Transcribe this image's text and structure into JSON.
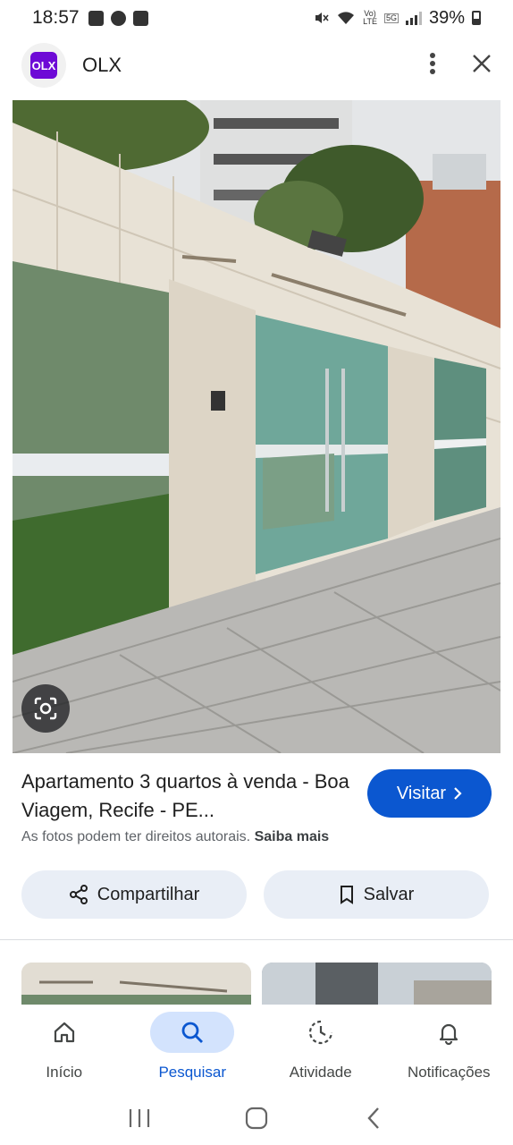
{
  "status_bar": {
    "time": "18:57",
    "battery": "39%",
    "network_labels": [
      "Vo)",
      "LTE",
      "5G"
    ],
    "icons": [
      "gallery-icon",
      "chat-icon",
      "check-icon",
      "mute-icon",
      "wifi-icon",
      "signal-icon",
      "battery-icon"
    ]
  },
  "header": {
    "logo_text": "OLX",
    "site_name": "OLX",
    "icons": [
      "more-vert-icon",
      "close-icon"
    ]
  },
  "result": {
    "title": "Apartamento 3 quartos à venda - Boa Viagem, Recife - PE...",
    "visit_label": "Visitar",
    "caption_text": "As fotos podem ter direitos autorais.",
    "caption_link": "Saiba mais"
  },
  "actions": {
    "share_label": "Compartilhar",
    "save_label": "Salvar"
  },
  "bottom_nav": {
    "items": [
      {
        "label": "Início",
        "icon": "home-icon",
        "active": false
      },
      {
        "label": "Pesquisar",
        "icon": "search-icon",
        "active": true
      },
      {
        "label": "Atividade",
        "icon": "activity-icon",
        "active": false
      },
      {
        "label": "Notificações",
        "icon": "bell-icon",
        "active": false
      }
    ]
  },
  "colors": {
    "accent": "#0b57d0",
    "pill_bg": "#e9eef6",
    "active_nav_bg": "#d3e3fd",
    "olx_purple": "#6e0ad6"
  }
}
